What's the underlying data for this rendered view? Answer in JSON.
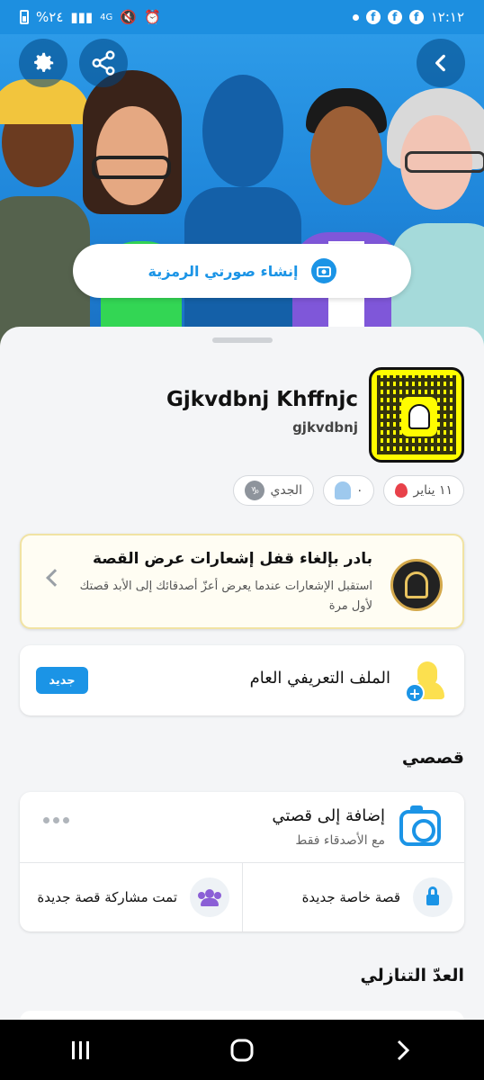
{
  "status_bar": {
    "time": "١٢:١٢",
    "battery": "%٢٤",
    "network": "4G"
  },
  "hero": {
    "create_avatar_label": "إنشاء صورتي الرمزية"
  },
  "profile": {
    "display_name": "Gjkvdbnj Khffnjc",
    "username": "gjkvdbnj",
    "chips": {
      "birthday": "١١ يناير",
      "friends_count": "٠",
      "zodiac": "الجدي"
    }
  },
  "promo": {
    "title": "بادر بإلغاء قفل إشعارات عرض القصة",
    "body": "استقبل الإشعارات عندما يعرض أعزّ أصدقائك إلى الأبد قصتك لأول مرة"
  },
  "public_profile": {
    "title": "الملف التعريفي العام",
    "badge": "جديد"
  },
  "my_stories": {
    "section_title": "قصصي",
    "add_title": "إضافة إلى قصتي",
    "add_subtitle": "مع الأصدقاء فقط",
    "private_story": "قصة خاصة جديدة",
    "shared_story": "تمت مشاركة قصة جديدة"
  },
  "countdown": {
    "section_title": "العدّ التنازلي"
  },
  "colors": {
    "accent": "#1b94e6",
    "snap_yellow": "#fffc00"
  }
}
